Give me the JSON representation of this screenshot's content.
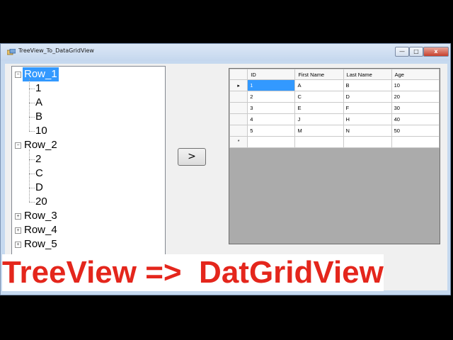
{
  "window": {
    "title": "TreeView_To_DataGridView",
    "controls": {
      "minimize": "—",
      "maximize": "□",
      "close": "x"
    }
  },
  "tree": {
    "nodes": [
      {
        "label": "Row_1",
        "expanded": true,
        "selected": true,
        "children": [
          "1",
          "A",
          "B",
          "10"
        ]
      },
      {
        "label": "Row_2",
        "expanded": true,
        "selected": false,
        "children": [
          "2",
          "C",
          "D",
          "20"
        ]
      },
      {
        "label": "Row_3",
        "expanded": false
      },
      {
        "label": "Row_4",
        "expanded": false
      },
      {
        "label": "Row_5",
        "expanded": false
      }
    ]
  },
  "move_button": {
    "label": ">"
  },
  "grid": {
    "columns": [
      "ID",
      "First Name",
      "Last Name",
      "Age"
    ],
    "rows": [
      [
        "1",
        "A",
        "B",
        "10"
      ],
      [
        "2",
        "C",
        "D",
        "20"
      ],
      [
        "3",
        "E",
        "F",
        "30"
      ],
      [
        "4",
        "J",
        "H",
        "40"
      ],
      [
        "5",
        "M",
        "N",
        "50"
      ]
    ],
    "current_row_marker": "▸",
    "new_row_marker": "*"
  },
  "caption": "TreeView =>  DatGridView",
  "colors": {
    "caption": "#e4261c",
    "selection": "#3399ff"
  }
}
